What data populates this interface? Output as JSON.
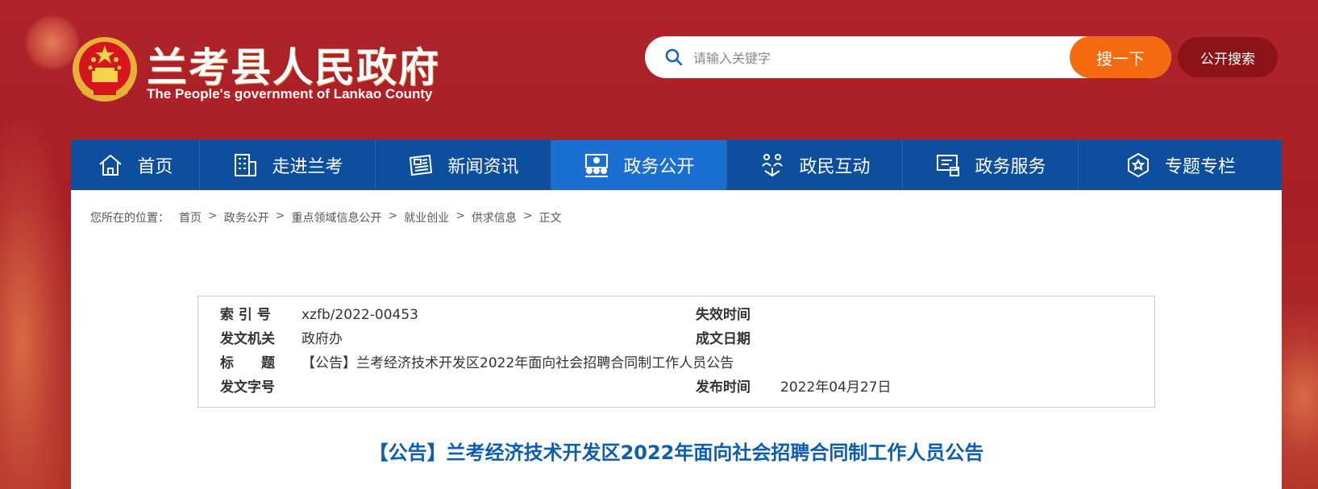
{
  "header": {
    "site_title": "兰考县人民政府",
    "site_subtitle": "The People's government of Lankao County",
    "search_placeholder": "请输入关键字",
    "search_button": "搜一下",
    "open_search": "公开搜索"
  },
  "nav": {
    "items": [
      {
        "label": "首页",
        "icon": "home-icon"
      },
      {
        "label": "走进兰考",
        "icon": "building-icon"
      },
      {
        "label": "新闻资讯",
        "icon": "newspaper-icon"
      },
      {
        "label": "政务公开",
        "icon": "people-board-icon",
        "active": true
      },
      {
        "label": "政民互动",
        "icon": "interaction-icon"
      },
      {
        "label": "政务服务",
        "icon": "service-icon"
      },
      {
        "label": "专题专栏",
        "icon": "badge-icon"
      }
    ]
  },
  "breadcrumb": {
    "prefix": "您所在的位置：",
    "items": [
      "首页",
      "政务公开",
      "重点领域信息公开",
      "就业创业",
      "供求信息",
      "正文"
    ],
    "separator": ">"
  },
  "info": {
    "index_label": "索 引 号",
    "index_value": "xzfb/2022-00453",
    "expire_label": "失效时间",
    "expire_value": "",
    "issuer_label": "发文机关",
    "issuer_value": "政府办",
    "date_label": "成文日期",
    "date_value": "",
    "title_label": "标　　题",
    "title_value": "【公告】兰考经济技术开发区2022年面向社会招聘合同制工作人员公告",
    "docno_label": "发文字号",
    "docno_value": "",
    "publish_label": "发布时间",
    "publish_value": "2022年04月27日"
  },
  "article": {
    "title": "【公告】兰考经济技术开发区2022年面向社会招聘合同制工作人员公告"
  },
  "colors": {
    "header_red": "#b0232a",
    "nav_blue": "#0d4f9e",
    "nav_active": "#1b6fd0",
    "search_orange": "#f46a0e",
    "title_blue": "#0d5db0"
  }
}
